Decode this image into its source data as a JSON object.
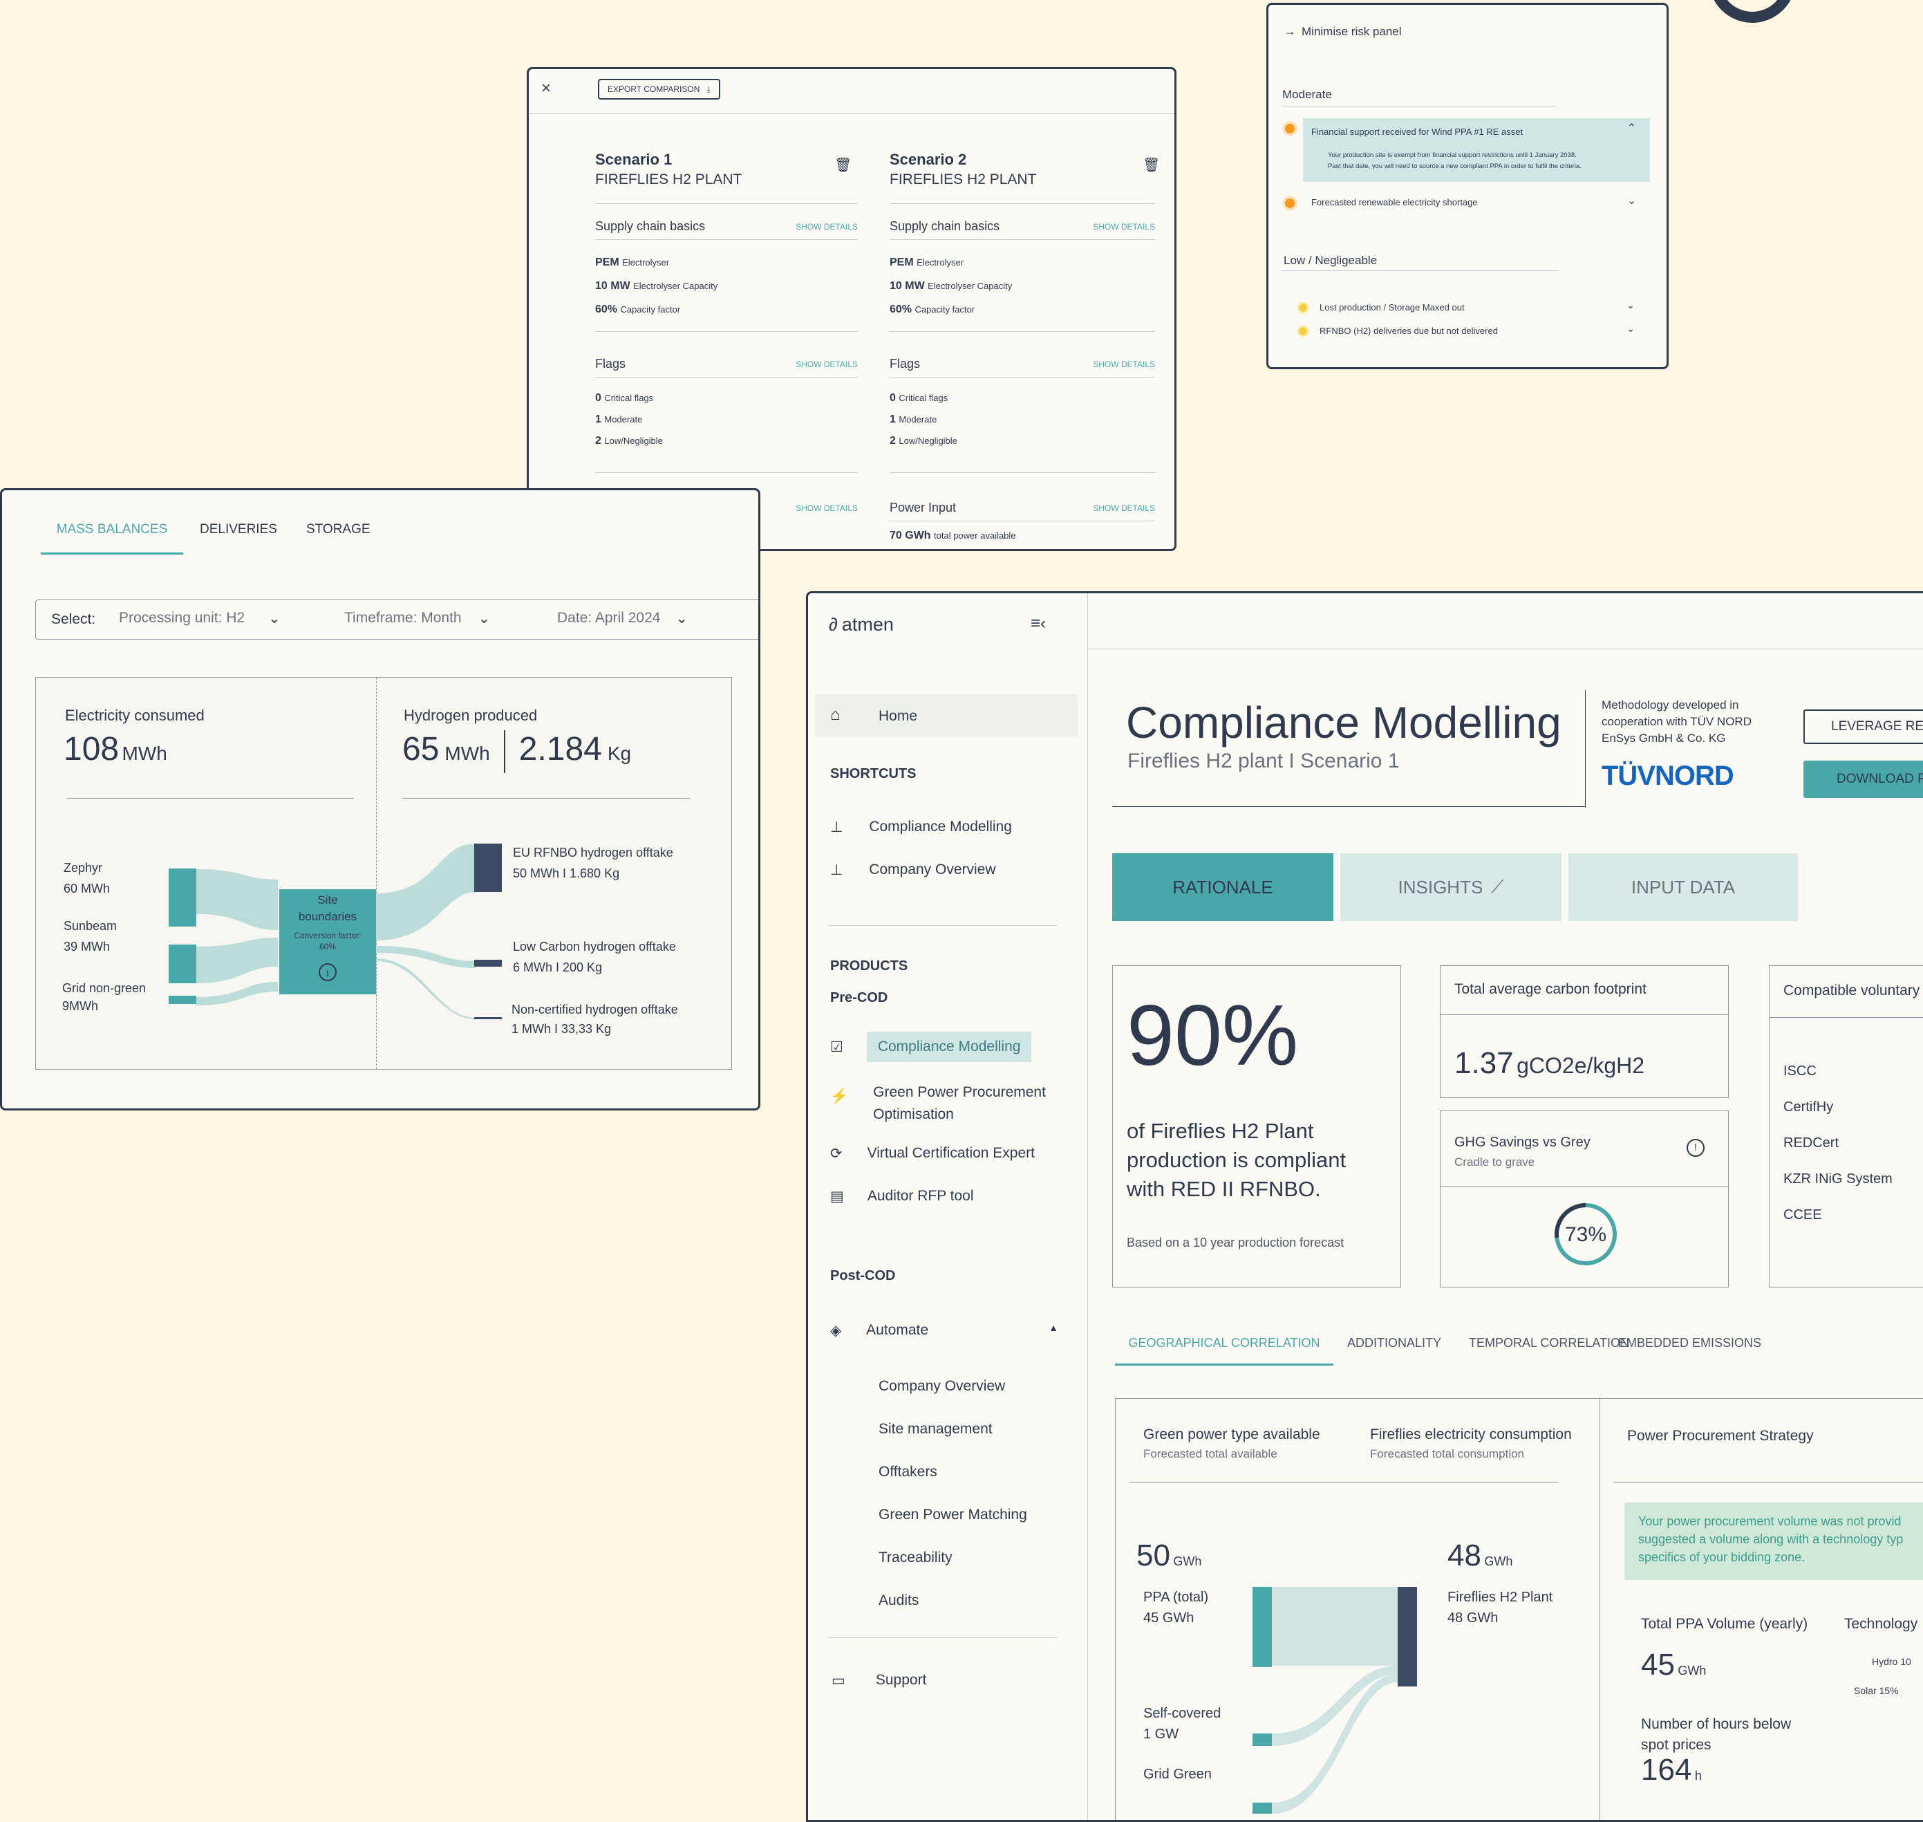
{
  "colors": {
    "background": "#fcf6e3",
    "dark": "#2f3a4e",
    "teal": "#4aa7a9",
    "light_teal": "#cfe6e5",
    "orange": "#f39a1d",
    "yellow": "#f5cf3d",
    "brand_tuv": "#1565c0"
  },
  "risk_panel": {
    "header": "Minimise risk panel",
    "moderate_title": "Moderate",
    "moderate_items": [
      {
        "label": "Financial support received for Wind PPA #1 RE asset",
        "detail_1": "Your production site is exempt from financial support restrictions until 1 January 2038.",
        "detail_2": "Past that date, you will need to source a new compliant PPA in order to fulfil the criteria."
      },
      {
        "label": "Forecasted renewable electricity shortage"
      }
    ],
    "low_title": "Low / Negligeable",
    "low_items": [
      {
        "label": "Lost production / Storage Maxed out"
      },
      {
        "label": "RFNBO (H2) deliveries due but not delivered"
      }
    ]
  },
  "comparison": {
    "export_label": "EXPORT COMPARISON",
    "scenarios": [
      {
        "title": "Scenario 1",
        "plant": "FIREFLIES H2 PLANT",
        "supply_title": "Supply chain basics",
        "show_details": "SHOW DETAILS",
        "supply": [
          {
            "bold": "PEM",
            "text": "Electrolyser"
          },
          {
            "bold": "10 MW",
            "text": "Electrolyser Capacity"
          },
          {
            "bold": "60%",
            "text": "Capacity factor"
          }
        ],
        "flags_title": "Flags",
        "flags": [
          {
            "bold": "0",
            "text": "Critical flags"
          },
          {
            "bold": "1",
            "text": "Moderate"
          },
          {
            "bold": "2",
            "text": "Low/Negligible"
          }
        ]
      },
      {
        "title": "Scenario 2",
        "plant": "FIREFLIES H2 PLANT",
        "supply_title": "Supply chain basics",
        "show_details": "SHOW DETAILS",
        "supply": [
          {
            "bold": "PEM",
            "text": "Electrolyser"
          },
          {
            "bold": "10 MW",
            "text": "Electrolyser Capacity"
          },
          {
            "bold": "60%",
            "text": "Capacity factor"
          }
        ],
        "flags_title": "Flags",
        "flags": [
          {
            "bold": "0",
            "text": "Critical flags"
          },
          {
            "bold": "1",
            "text": "Moderate"
          },
          {
            "bold": "2",
            "text": "Low/Negligible"
          }
        ],
        "power_title": "Power Input",
        "power_bold": "70 GWh",
        "power_text": "total power available"
      }
    ]
  },
  "mass": {
    "tabs": [
      "MASS BALANCES",
      "DELIVERIES",
      "STORAGE"
    ],
    "select_label": "Select:",
    "processing": "Processing unit: H2",
    "timeframe": "Timeframe: Month",
    "date": "Date: April 2024",
    "elec_title": "Electricity consumed",
    "elec_value": "108",
    "elec_unit": "MWh",
    "h2_title": "Hydrogen produced",
    "h2_value": "65",
    "h2_unit": "MWh",
    "h2_kg_value": "2.184",
    "h2_kg_unit": "Kg",
    "sources": [
      {
        "name": "Zephyr",
        "value": "60 MWh"
      },
      {
        "name": "Sunbeam",
        "value": "39 MWh"
      },
      {
        "name": "Grid non-green",
        "value": "9MWh"
      }
    ],
    "site_title_1": "Site",
    "site_title_2": "boundaries",
    "site_conv": "Conversion factor:",
    "site_conv_value": "60%",
    "outputs": [
      {
        "name": "EU RFNBO hydrogen offtake",
        "value": "50 MWh I 1.680 Kg"
      },
      {
        "name": "Low Carbon hydrogen offtake",
        "value": "6 MWh I 200 Kg"
      },
      {
        "name": "Non-certified hydrogen offtake",
        "value": "1 MWh I 33,33 Kg"
      }
    ]
  },
  "sidebar": {
    "logo": "atmen",
    "home": "Home",
    "shortcuts_title": "SHORTCUTS",
    "shortcuts": [
      "Compliance Modelling",
      "Company Overview"
    ],
    "products_title": "PRODUCTS",
    "precod_title": "Pre-COD",
    "precod": [
      "Compliance Modelling",
      "Green Power Procurement Optimisation",
      "Virtual Certification Expert",
      "Auditor RFP tool"
    ],
    "postcod_title": "Post-COD",
    "automate": "Automate",
    "automate_items": [
      "Company Overview",
      "Site management",
      "Offtakers",
      "Green Power Matching",
      "Traceability",
      "Audits"
    ],
    "support": "Support"
  },
  "main": {
    "title": "Compliance Modelling",
    "subtitle": "Fireflies H2 plant I Scenario 1",
    "methodology": "Methodology developed in cooperation with TÜV NORD EnSys GmbH & Co. KG",
    "tuv_logo": "TÜVNORD",
    "leverage_btn": "LEVERAGE REP",
    "download_btn": "DOWNLOAD R",
    "tabs": [
      "RATIONALE",
      "INSIGHTS",
      "INPUT DATA"
    ],
    "compliance_pct": "90%",
    "compliance_text": "of Fireflies H2 Plant production is compliant with RED II RFNBO.",
    "compliance_note": "Based on a 10 year production forecast",
    "carbon_title": "Total average carbon footprint",
    "carbon_value": "1.37",
    "carbon_unit": "gCO2e/kgH2",
    "ghg_title": "GHG Savings vs Grey",
    "ghg_sub": "Cradle to grave",
    "ghg_value": "73%",
    "ghg_fraction": 0.73,
    "voluntary_title": "Compatible voluntary",
    "voluntary": [
      "ISCC",
      "CertifHy",
      "REDCert",
      "KZR INiG System",
      "CCEE"
    ],
    "sub_tabs": [
      "GEOGRAPHICAL CORRELATION",
      "ADDITIONALITY",
      "TEMPORAL CORRELATION",
      "EMBEDDED EMISSIONS"
    ],
    "green_title": "Green power type available",
    "green_sub": "Forecasted total available",
    "cons_title": "Fireflies electricity consumption",
    "cons_sub": "Forecasted total consumption",
    "green_value": "50",
    "green_unit": "GWh",
    "cons_value": "48",
    "cons_unit": "GWh",
    "ppa": "PPA (total)",
    "ppa_value": "45 GWh",
    "self": "Self-covered",
    "self_value": "1 GW",
    "grid": "Grid Green",
    "plant": "Fireflies H2 Plant",
    "plant_value": "48 GWh",
    "strategy_title": "Power Procurement Strategy",
    "alert_1": "Your power procurement volume was not provid",
    "alert_2": "suggested a volume along with a technology typ",
    "alert_3": "specifics of your bidding zone.",
    "ppa_vol_title": "Total PPA Volume (yearly)",
    "ppa_vol_value": "45",
    "ppa_vol_unit": "GWh",
    "tech_title": "Technology",
    "hours_title_1": "Number of hours below",
    "hours_title_2": "spot prices",
    "hours_value": "164",
    "hours_unit": "h",
    "hydro_label": "Hydro 10",
    "solar_label": "Solar 15%"
  }
}
